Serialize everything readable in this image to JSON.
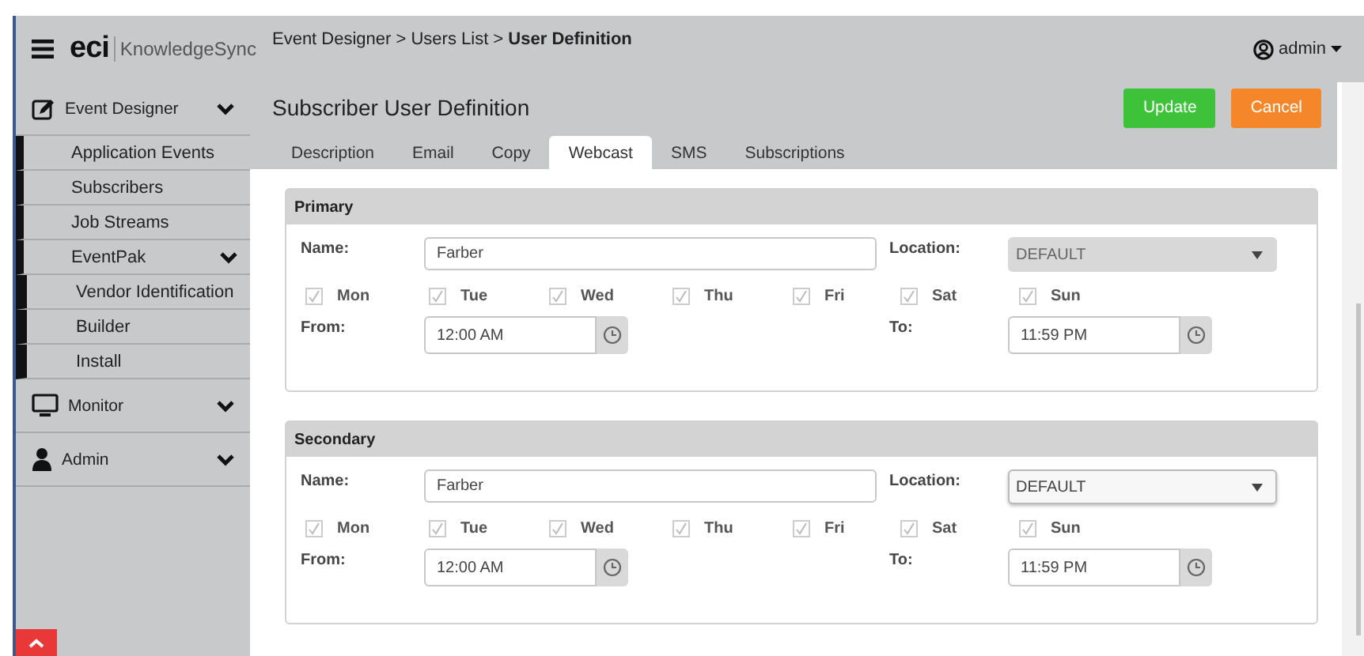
{
  "header": {
    "logo": "eci",
    "app_name": "KnowledgeSync",
    "breadcrumb": "Event Designer > Users List > **User Definition**",
    "user": "admin"
  },
  "sidebar": {
    "sections": [
      {
        "label": "Event Designer",
        "children": [
          {
            "label": "Application Events"
          },
          {
            "label": "Subscribers"
          },
          {
            "label": "Job Streams"
          },
          {
            "label": "EventPak",
            "children": [
              {
                "label": "Vendor Identification"
              },
              {
                "label": "Builder"
              },
              {
                "label": "Install"
              }
            ]
          }
        ]
      },
      {
        "label": "Monitor"
      },
      {
        "label": "Admin"
      }
    ]
  },
  "page": {
    "title": "Subscriber User Definition",
    "buttons": [
      {
        "label": "Update",
        "kind": "primary"
      },
      {
        "label": "Cancel",
        "kind": "cancel"
      }
    ]
  },
  "tabs": [
    {
      "label": "Description",
      "selected": false
    },
    {
      "label": "Email",
      "selected": false
    },
    {
      "label": "Copy",
      "selected": false
    },
    {
      "label": "Webcast",
      "selected": true
    },
    {
      "label": "SMS",
      "selected": false
    },
    {
      "label": "Subscriptions",
      "selected": false
    }
  ],
  "panels": [
    {
      "title": "Primary",
      "name_label": "Name:",
      "name": "Farber",
      "location_label": "Location:",
      "location": "DEFAULT",
      "location_disabled": true,
      "days": [
        {
          "label": "Mon",
          "checked": true
        },
        {
          "label": "Tue",
          "checked": true
        },
        {
          "label": "Wed",
          "checked": true
        },
        {
          "label": "Thu",
          "checked": true
        },
        {
          "label": "Fri",
          "checked": true
        },
        {
          "label": "Sat",
          "checked": true
        },
        {
          "label": "Sun",
          "checked": true
        }
      ],
      "from_label": "From:",
      "from": "12:00 AM",
      "to_label": "To:",
      "to": "11:59 PM"
    },
    {
      "title": "Secondary",
      "name_label": "Name:",
      "name": "Farber",
      "location_label": "Location:",
      "location": "DEFAULT",
      "location_disabled": false,
      "days": [
        {
          "label": "Mon",
          "checked": true
        },
        {
          "label": "Tue",
          "checked": true
        },
        {
          "label": "Wed",
          "checked": true
        },
        {
          "label": "Thu",
          "checked": true
        },
        {
          "label": "Fri",
          "checked": true
        },
        {
          "label": "Sat",
          "checked": true
        },
        {
          "label": "Sun",
          "checked": true
        }
      ],
      "from_label": "From:",
      "from": "12:00 AM",
      "to_label": "To:",
      "to": "11:59 PM"
    }
  ]
}
